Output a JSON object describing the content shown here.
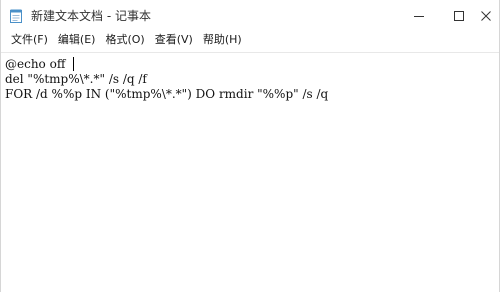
{
  "window": {
    "title": "新建文本文档 - 记事本",
    "icons": {
      "app": "notepad-icon",
      "minimize": "minimize-icon",
      "maximize": "maximize-icon",
      "close": "close-icon"
    }
  },
  "menu": {
    "items": [
      {
        "label": "文件(F)"
      },
      {
        "label": "编辑(E)"
      },
      {
        "label": "格式(O)"
      },
      {
        "label": "查看(V)"
      },
      {
        "label": "帮助(H)"
      }
    ]
  },
  "editor": {
    "lines": [
      "@echo off",
      "del \"%tmp%\\*.*\" /s /q /f",
      "FOR /d %%p IN (\"%tmp%\\*.*\") DO rmdir \"%%p\" /s /q"
    ]
  }
}
